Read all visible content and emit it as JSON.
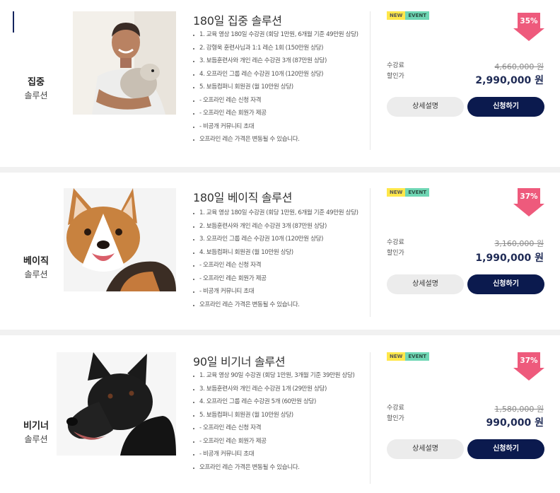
{
  "plans": [
    {
      "tier_line1": "집중",
      "tier_line2": "솔루션",
      "title": "180일 집중 솔루션",
      "features": [
        "1. 교육 영상 180일 수강권 (회당 1만원, 6개월 기준 49만원 상당)",
        "2. 강형욱 훈련사님과 1:1 레슨 1회 (150만원 상당)",
        "3. 보듬훈련사와 개인 레슨 수강권 3개 (87만원 상당)",
        "4. 오프라인 그룹 레슨 수강권 10개 (120만원 상당)",
        "5. 보듬컴퍼니 회원권 (월 10만원 상당)",
        "- 오프라인 레슨 신청 자격",
        "- 오프라인 레슨 회원가 제공",
        "- 비공개 커뮤니티 초대",
        "오프라인 레슨 가격은 변동될 수 있습니다."
      ],
      "tag_new": "NEW",
      "tag_event": "EVENT",
      "discount": "35%",
      "label_price": "수강료",
      "label_sale": "할인가",
      "original_price": "4,660,000 원",
      "sale_price": "2,990,000 원",
      "btn_detail": "상세설명",
      "btn_apply": "신청하기",
      "photo": "trainer-with-dog"
    },
    {
      "tier_line1": "베이직",
      "tier_line2": "솔루션",
      "title": "180일 베이직 솔루션",
      "features": [
        "1. 교육 영상 180일 수강권 (회당 1만원, 6개월 기준 49만원 상당)",
        "2. 보듬훈련사와 개인 레슨 수강권 3개 (87만원 상당)",
        "3. 오프라인 그룹 레슨 수강권 10개 (120만원 상당)",
        "4. 보듬컴퍼니 회원권 (월 10만원 상당)",
        "- 오프라인 레슨 신청 자격",
        "- 오프라인 레슨 회원가 제공",
        "- 비공개 커뮤니티 초대",
        "오프라인 레슨 가격은 변동될 수 있습니다."
      ],
      "tag_new": "NEW",
      "tag_event": "EVENT",
      "discount": "37%",
      "label_price": "수강료",
      "label_sale": "할인가",
      "original_price": "3,160,000 원",
      "sale_price": "1,990,000 원",
      "btn_detail": "상세설명",
      "btn_apply": "신청하기",
      "photo": "corgi"
    },
    {
      "tier_line1": "비기너",
      "tier_line2": "솔루션",
      "title": "90일 비기너 솔루션",
      "features": [
        "1. 교육 영상 90일 수강권 (회당 1만원, 3개월 기준 39만원 상당)",
        "3. 보듬훈련사와 개인 레슨 수강권 1개 (29만원 상당)",
        "4. 오프라인 그룹 레슨 수강권 5개 (60만원 상당)",
        "5. 보듬컴퍼니 회원권 (월 10만원 상당)",
        "- 오프라인 레슨 신청 자격",
        "- 오프라인 레슨 회원가 제공",
        "- 비공개 커뮤니티 초대",
        "오프라인 레슨 가격은 변동될 수 있습니다."
      ],
      "tag_new": "NEW",
      "tag_event": "EVENT",
      "discount": "37%",
      "label_price": "수강료",
      "label_sale": "할인가",
      "original_price": "1,580,000 원",
      "sale_price": "990,000 원",
      "btn_detail": "상세설명",
      "btn_apply": "신청하기",
      "photo": "black-shepherd"
    }
  ],
  "colors": {
    "navy": "#0b1a4e",
    "discount_pink": "#ee5a7c",
    "tag_new": "#ffe74a",
    "tag_event": "#6fd6b4"
  },
  "icons": {
    "premium_badge": "crown-icon",
    "discount": "down-arrow-badge"
  }
}
